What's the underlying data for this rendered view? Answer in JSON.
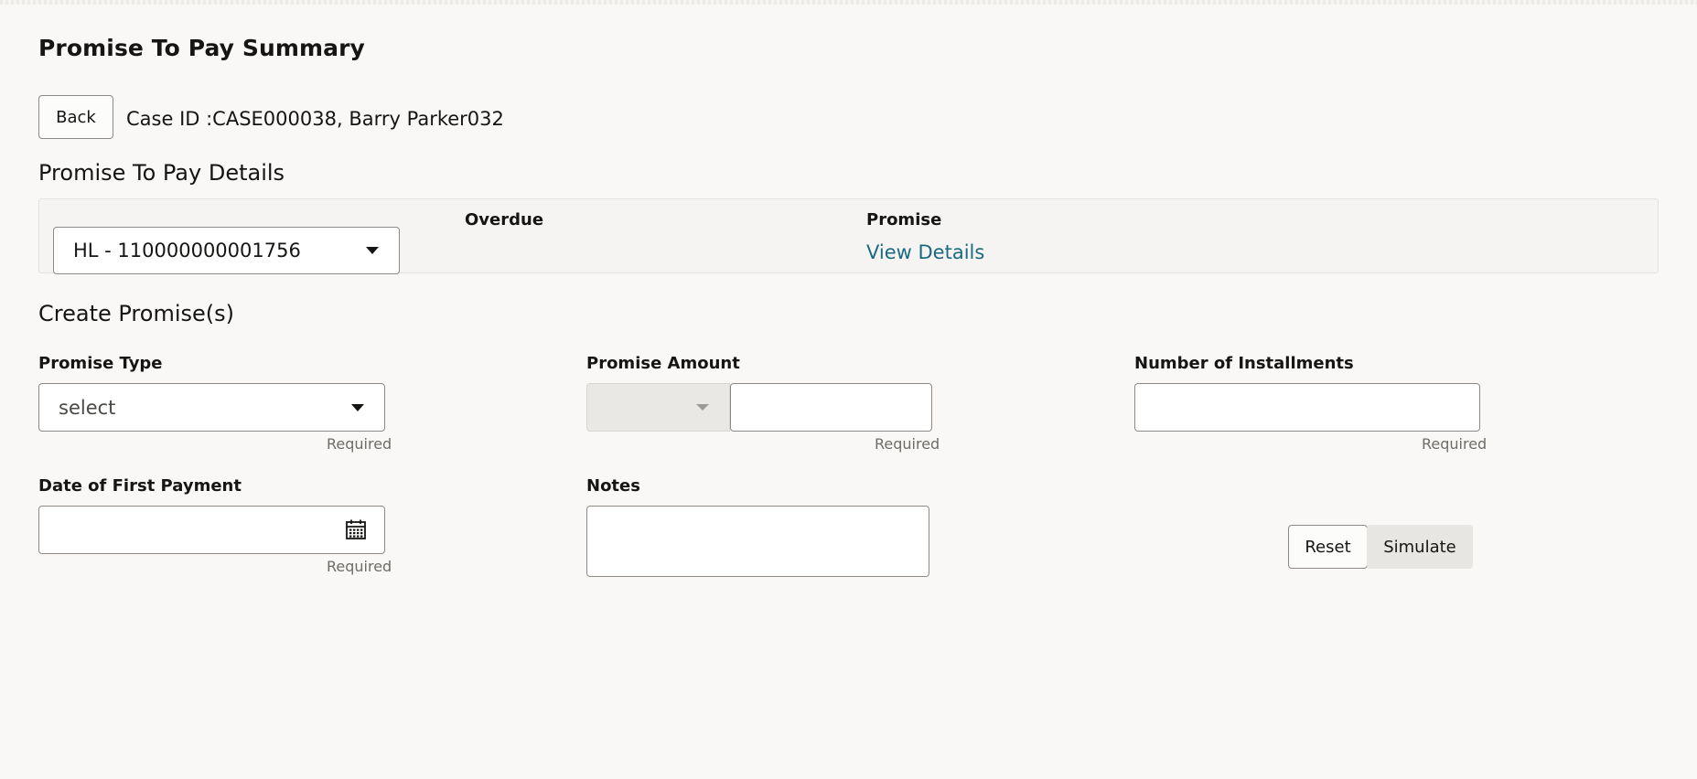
{
  "page": {
    "title": "Promise To Pay Summary"
  },
  "header": {
    "back_label": "Back",
    "case_info": "Case ID :CASE000038,  Barry Parker032"
  },
  "details": {
    "section_title": "Promise To Pay Details",
    "account_selected": "HL - 110000000001756",
    "overdue_label": "Overdue",
    "promise_label": "Promise",
    "view_details_link": "View Details"
  },
  "create": {
    "section_title": "Create Promise(s)",
    "promise_type": {
      "label": "Promise Type",
      "selected": "select",
      "hint": "Required"
    },
    "promise_amount": {
      "label": "Promise Amount",
      "currency_selected": "",
      "value": "",
      "hint": "Required"
    },
    "installments": {
      "label": "Number of Installments",
      "value": "",
      "hint": "Required"
    },
    "first_payment_date": {
      "label": "Date of First Payment",
      "value": "",
      "hint": "Required",
      "icon": "calendar-icon"
    },
    "notes": {
      "label": "Notes",
      "value": ""
    },
    "reset_label": "Reset",
    "simulate_label": "Simulate"
  },
  "colors": {
    "link": "#1b6a80",
    "background": "#f9f8f6",
    "border": "#8d8a86",
    "simulate_bg": "#e7e6e3"
  }
}
